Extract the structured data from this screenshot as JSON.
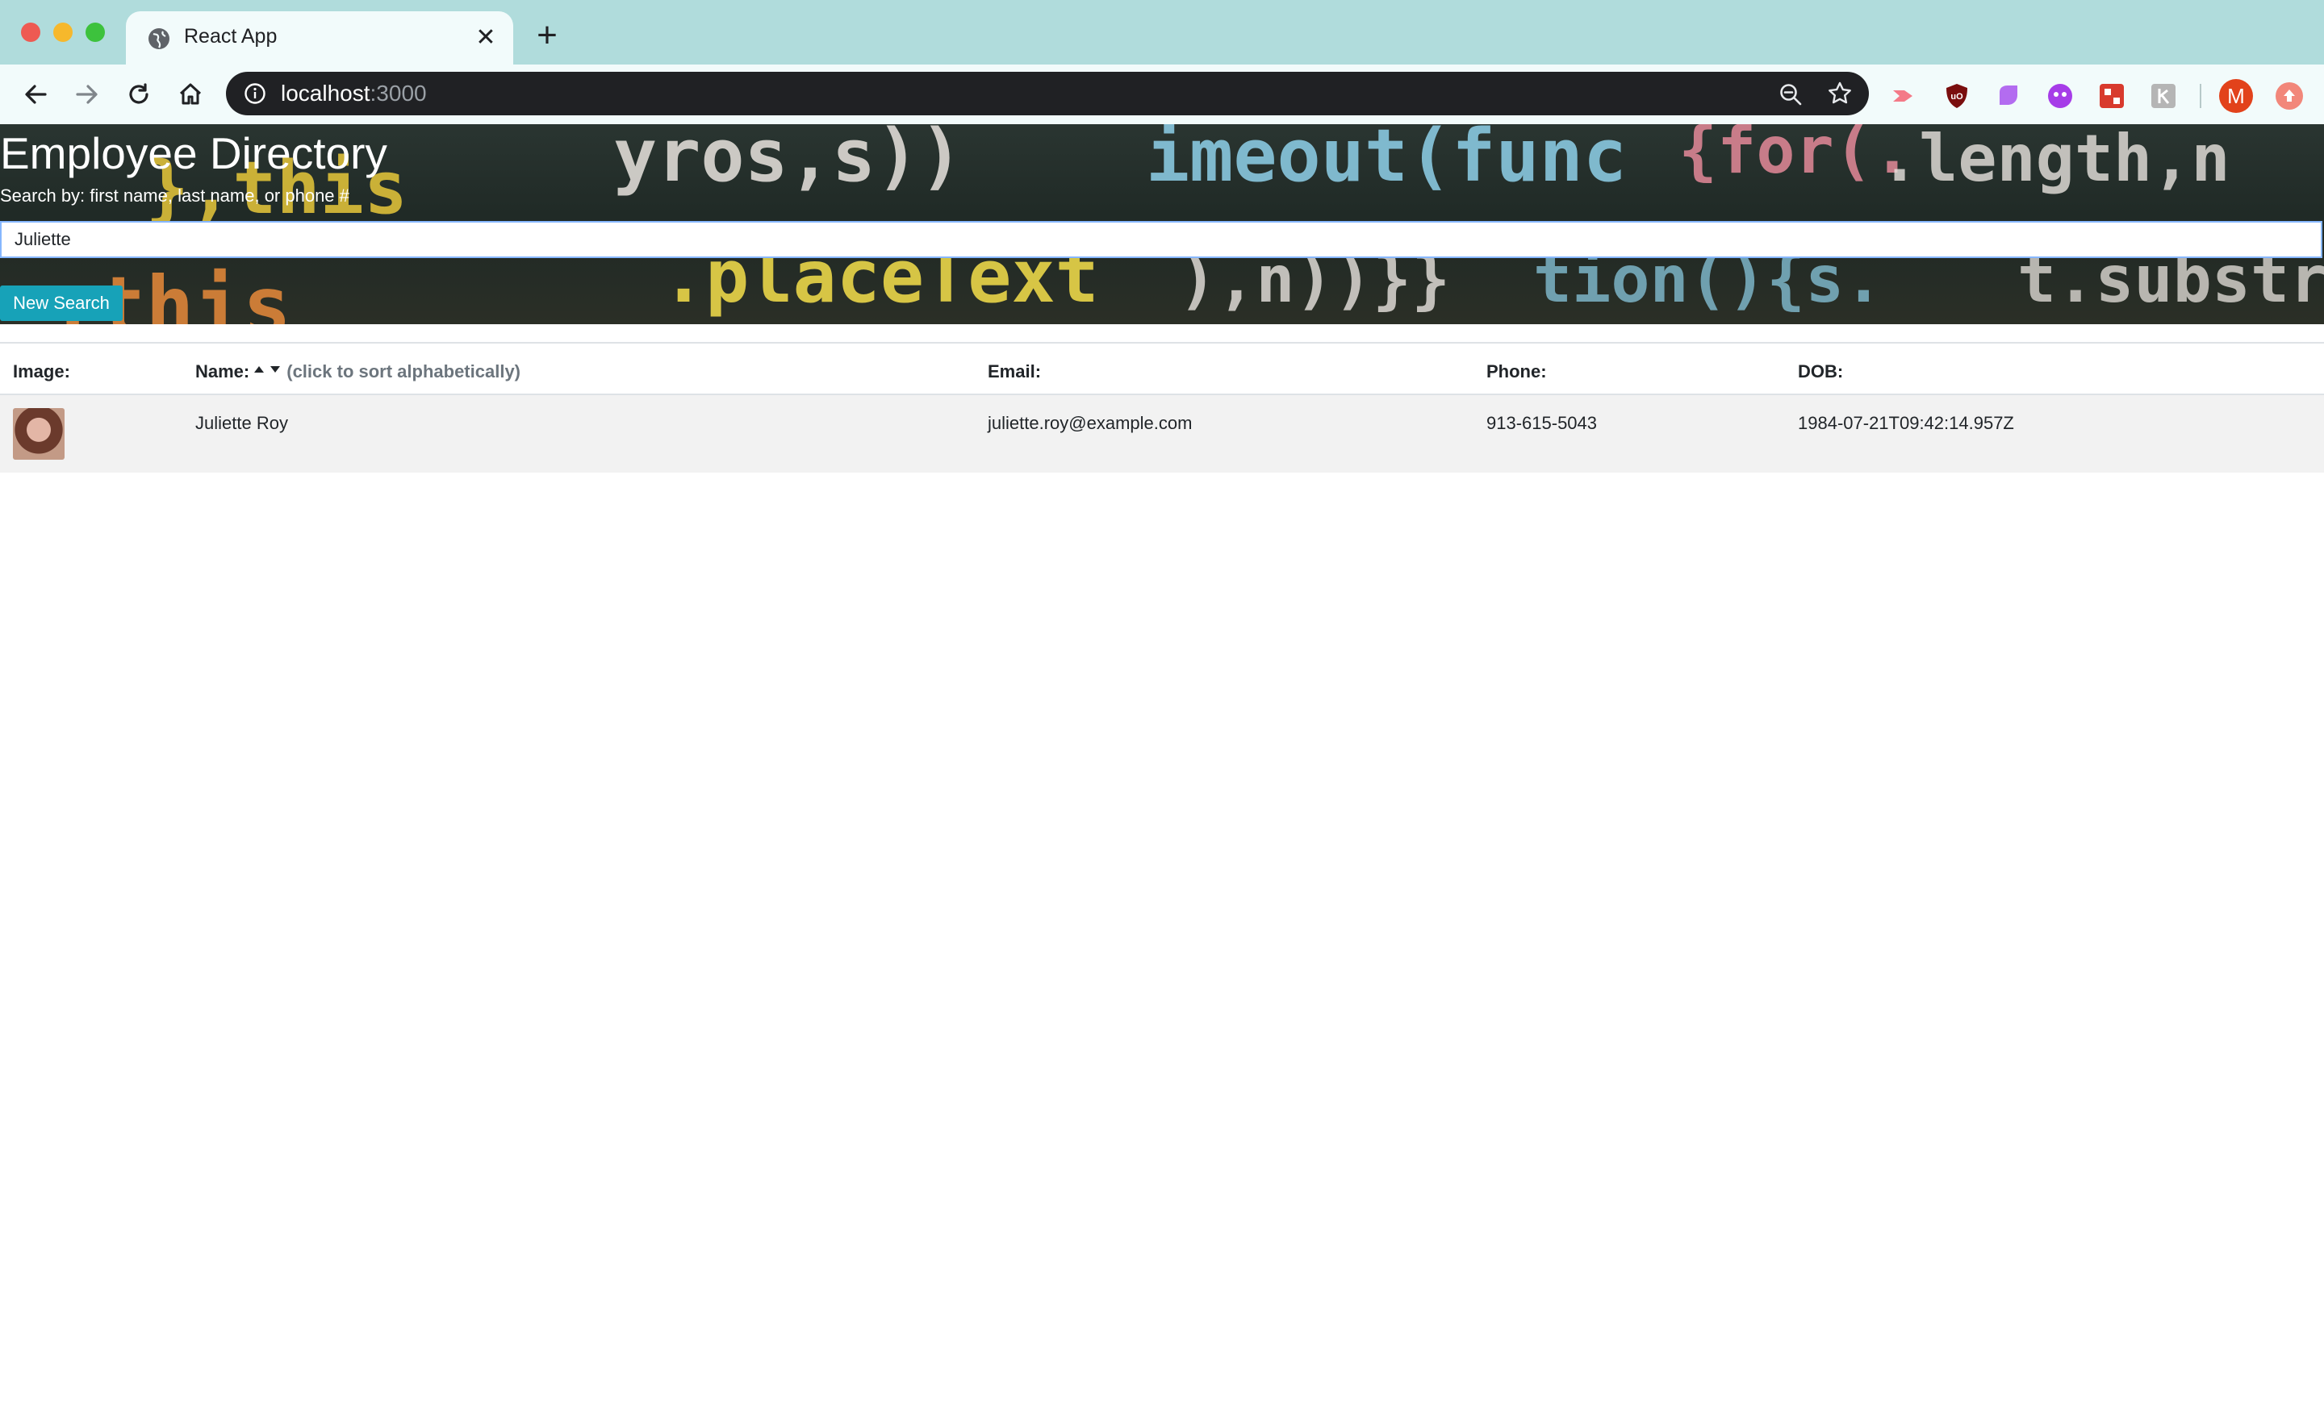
{
  "browser": {
    "tab_title": "React App",
    "address_host": "localhost",
    "address_port": ":3000",
    "profile_initial": "M"
  },
  "header": {
    "title": "Employee Directory",
    "subtitle": "Search by: first name, last name, or phone #",
    "search_value": "Juliette",
    "new_search_label": "New Search"
  },
  "table": {
    "columns": {
      "image": "Image:",
      "name": "Name:",
      "name_hint": "(click to sort alphabetically)",
      "email": "Email:",
      "phone": "Phone:",
      "dob": "DOB:"
    },
    "rows": [
      {
        "name": "Juliette Roy",
        "email": "juliette.roy@example.com",
        "phone": "913-615-5043",
        "dob": "1984-07-21T09:42:14.957Z"
      }
    ]
  },
  "colors": {
    "tabstrip": "#b0dcdc",
    "button": "#17a2b8",
    "row_stripe": "#f2f2f2"
  }
}
